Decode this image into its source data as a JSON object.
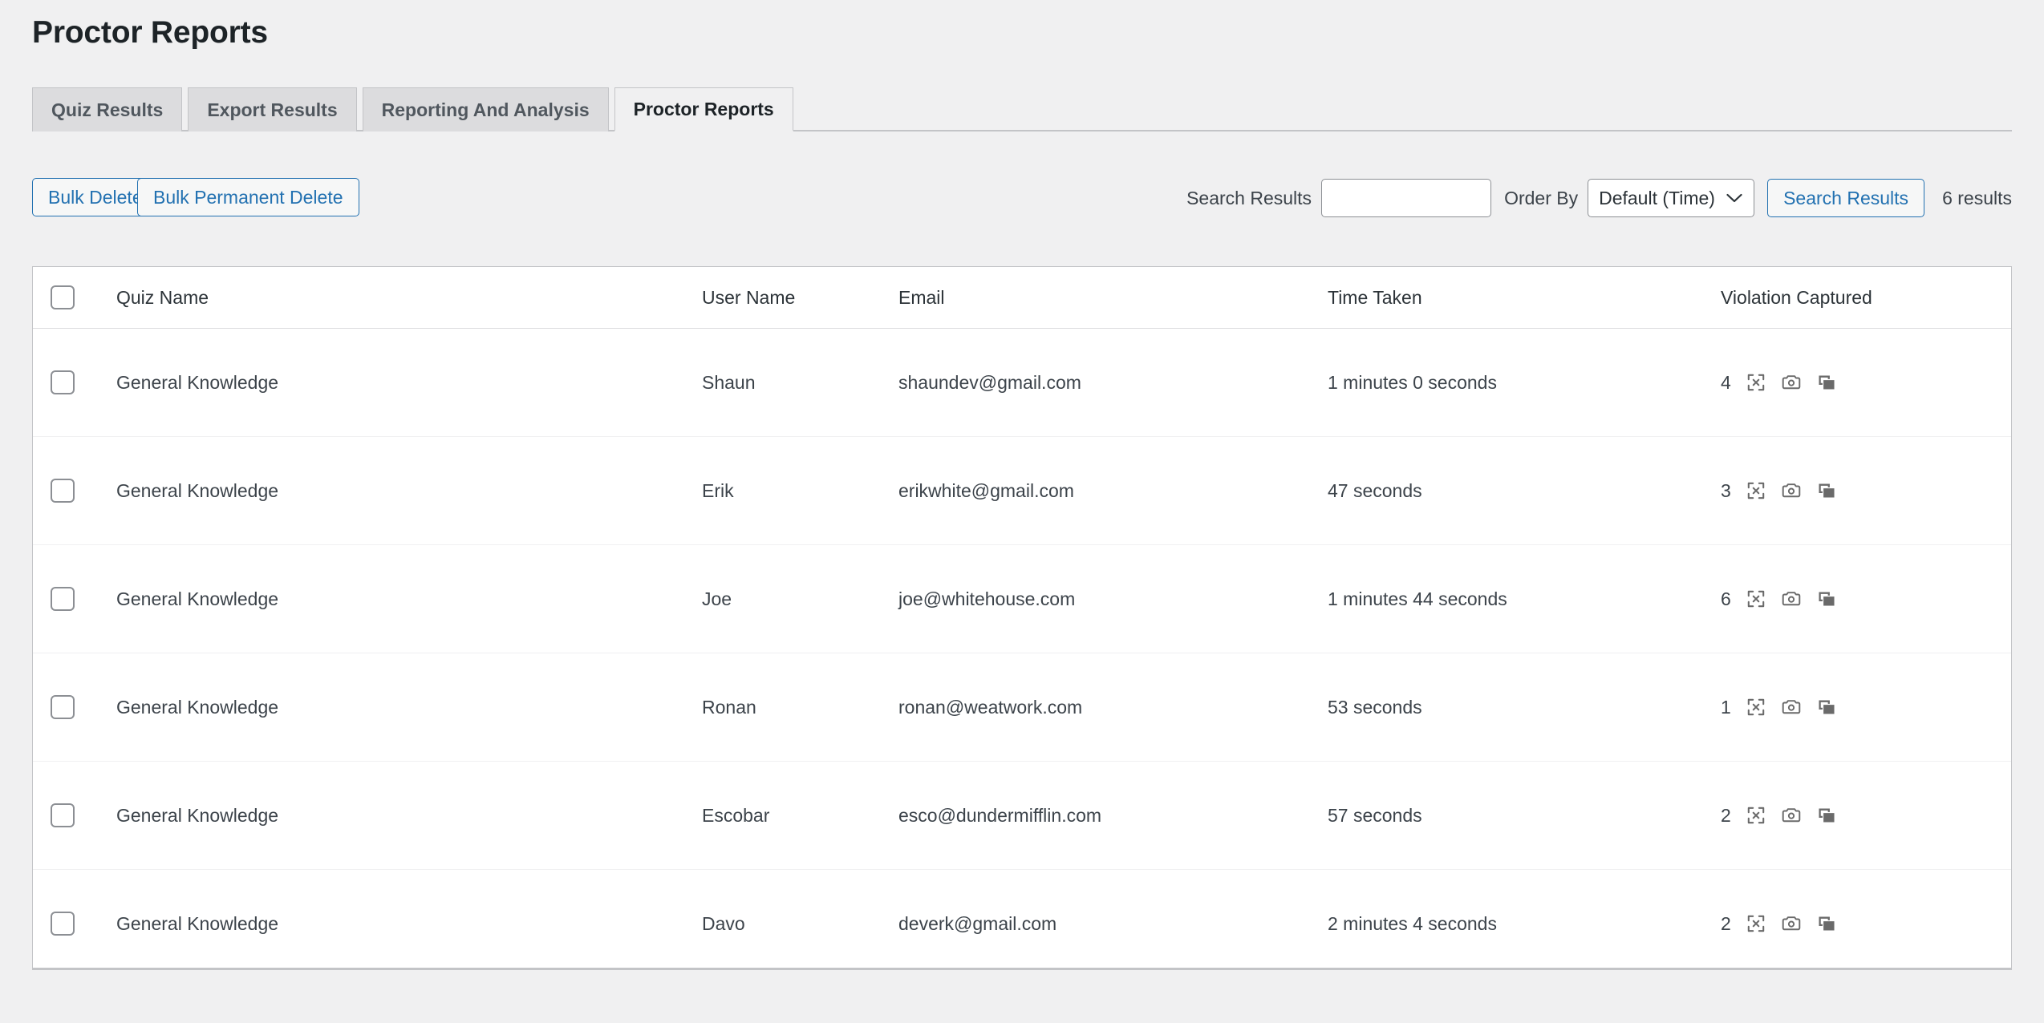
{
  "page": {
    "title": "Proctor Reports"
  },
  "tabs": [
    {
      "label": "Quiz Results",
      "active": false
    },
    {
      "label": "Export Results",
      "active": false
    },
    {
      "label": "Reporting And Analysis",
      "active": false
    },
    {
      "label": "Proctor Reports",
      "active": true
    }
  ],
  "toolbar": {
    "bulk_delete_label": "Bulk Delete",
    "bulk_permanent_delete_label": "Bulk Permanent Delete",
    "search_label": "Search Results",
    "search_value": "",
    "search_placeholder": "",
    "order_by_label": "Order By",
    "order_by_value": "Default (Time)",
    "order_by_options": [
      "Default (Time)"
    ],
    "search_button_label": "Search Results",
    "results_count": "6 results"
  },
  "table": {
    "columns": [
      {
        "key": "checkbox",
        "label": ""
      },
      {
        "key": "quiz_name",
        "label": "Quiz Name"
      },
      {
        "key": "user_name",
        "label": "User Name"
      },
      {
        "key": "email",
        "label": "Email"
      },
      {
        "key": "time_taken",
        "label": "Time Taken"
      },
      {
        "key": "violation_captured",
        "label": "Violation Captured"
      }
    ],
    "rows": [
      {
        "quiz_name": "General Knowledge",
        "user_name": "Shaun",
        "email": "shaundev@gmail.com",
        "time_taken": "1 minutes 0 seconds",
        "violation_count": "4"
      },
      {
        "quiz_name": "General Knowledge",
        "user_name": "Erik",
        "email": "erikwhite@gmail.com",
        "time_taken": "47 seconds",
        "violation_count": "3"
      },
      {
        "quiz_name": "General Knowledge",
        "user_name": "Joe",
        "email": "joe@whitehouse.com",
        "time_taken": "1 minutes 44 seconds",
        "violation_count": "6"
      },
      {
        "quiz_name": "General Knowledge",
        "user_name": "Ronan",
        "email": "ronan@weatwork.com",
        "time_taken": "53 seconds",
        "violation_count": "1"
      },
      {
        "quiz_name": "General Knowledge",
        "user_name": "Escobar",
        "email": "esco@dundermifflin.com",
        "time_taken": "57 seconds",
        "violation_count": "2"
      },
      {
        "quiz_name": "General Knowledge",
        "user_name": "Davo",
        "email": "deverk@gmail.com",
        "time_taken": "2 minutes 4 seconds",
        "violation_count": "2"
      }
    ],
    "row_icons": [
      "expand-icon",
      "camera-icon",
      "duplicate-windows-icon"
    ]
  },
  "colors": {
    "page_background": "#f0f0f1",
    "accent_blue": "#2271b1",
    "text_dark": "#1d2327",
    "text_body": "#3c434a",
    "border_gray": "#c3c4c7",
    "tab_inactive_bg": "#dcdcde",
    "icon_gray": "#6a6a6a"
  }
}
